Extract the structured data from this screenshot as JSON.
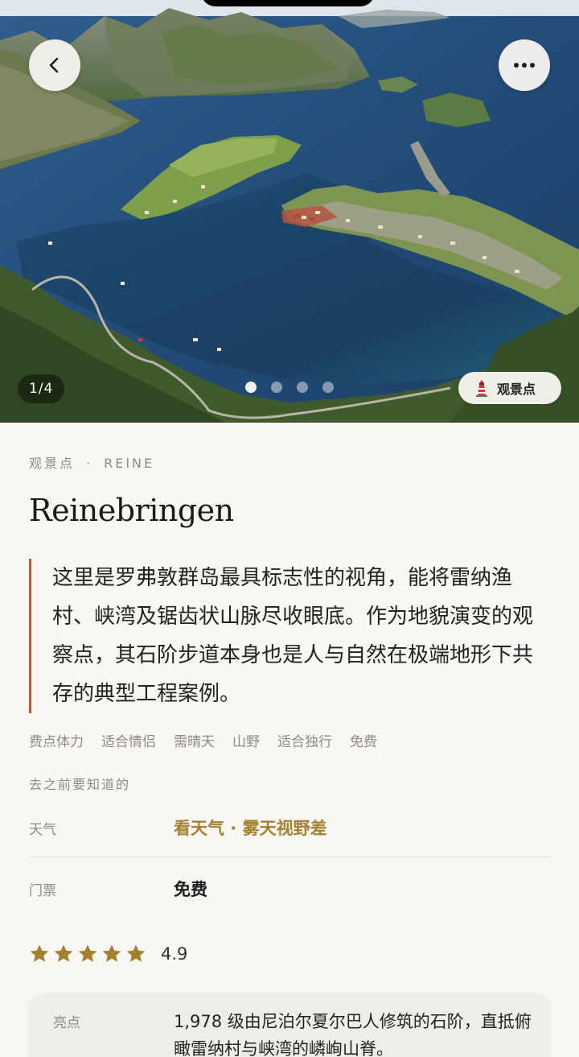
{
  "hero": {
    "counter": "1/4",
    "dots": [
      true,
      false,
      false,
      false
    ],
    "category_pill": "观景点"
  },
  "header": {
    "category": "观景点",
    "separator": "·",
    "location": "REINE",
    "title": "Reinebringen"
  },
  "description": "这里是罗弗敦群岛最具标志性的视角，能将雷纳渔村、峡湾及锯齿状山脉尽收眼底。作为地貌演变的观察点，其石阶步道本身也是人与自然在极端地形下共存的典型工程案例。",
  "tags": [
    "费点体力",
    "适合情侣",
    "需晴天",
    "山野",
    "适合独行",
    "免费"
  ],
  "know_before": {
    "label": "去之前要知道的",
    "weather": {
      "label": "天气",
      "value": "看天气 · 雾天视野差"
    },
    "ticket": {
      "label": "门票",
      "value": "免费"
    }
  },
  "rating": {
    "stars": 5,
    "score": "4.9"
  },
  "highlight": {
    "label": "亮点",
    "text": "1,978 级由尼泊尔夏尔巴人修筑的石阶，直抵俯瞰雷纳村与峡湾的嶙峋山脊。"
  },
  "colors": {
    "accent_gold": "#a6802f",
    "accent_rust": "#b45a3c",
    "background": "#f8f7f3",
    "muted_text": "#8e8b84"
  },
  "icons": {
    "back": "chevron-left-icon",
    "more": "more-horizontal-icon",
    "category": "lighthouse-icon",
    "star": "star-icon"
  }
}
